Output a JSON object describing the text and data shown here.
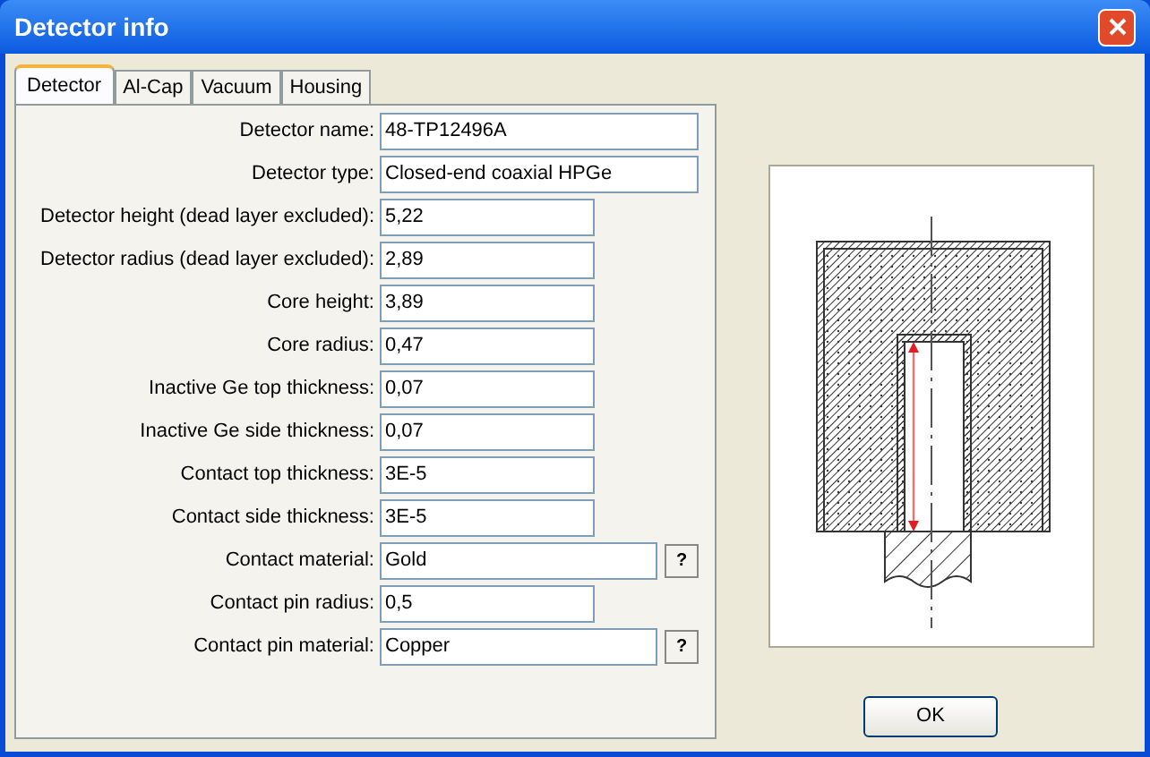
{
  "window": {
    "title": "Detector info"
  },
  "tabs": [
    {
      "label": "Detector",
      "selected": true
    },
    {
      "label": "Al-Cap",
      "selected": false
    },
    {
      "label": "Vacuum",
      "selected": false
    },
    {
      "label": "Housing",
      "selected": false
    }
  ],
  "fields": [
    {
      "label": "Detector name:",
      "value": "48-TP12496A",
      "kind": "long"
    },
    {
      "label": "Detector type:",
      "value": "Closed-end coaxial HPGe",
      "kind": "long"
    },
    {
      "label": "Detector height (dead layer excluded):",
      "value": "5,22",
      "kind": "short"
    },
    {
      "label": "Detector radius (dead layer excluded):",
      "value": "2,89",
      "kind": "short"
    },
    {
      "label": "Core height:",
      "value": "3,89",
      "kind": "short"
    },
    {
      "label": "Core radius:",
      "value": "0,47",
      "kind": "short"
    },
    {
      "label": "Inactive Ge top thickness:",
      "value": "0,07",
      "kind": "short"
    },
    {
      "label": "Inactive Ge side thickness:",
      "value": "0,07",
      "kind": "short"
    },
    {
      "label": "Contact top thickness:",
      "value": "3E-5",
      "kind": "short"
    },
    {
      "label": "Contact side thickness:",
      "value": "3E-5",
      "kind": "short"
    },
    {
      "label": "Contact material:",
      "value": "Gold",
      "kind": "lookup",
      "button": "?"
    },
    {
      "label": "Contact pin radius:",
      "value": "0,5",
      "kind": "short"
    },
    {
      "label": "Contact pin material:",
      "value": "Copper",
      "kind": "lookup",
      "button": "?"
    }
  ],
  "ok_button": "OK"
}
